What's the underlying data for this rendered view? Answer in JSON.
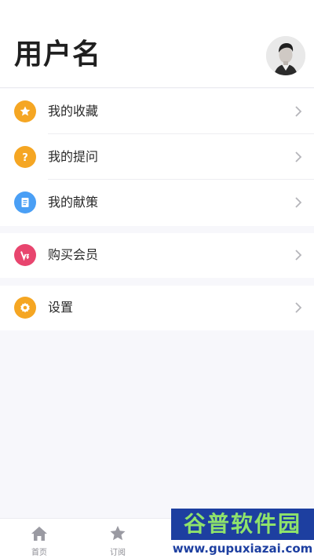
{
  "profile": {
    "username": "用户名"
  },
  "menu": {
    "group1": [
      {
        "label": "我的收藏",
        "icon": "star-icon",
        "color": "#f5a623"
      },
      {
        "label": "我的提问",
        "icon": "question-icon",
        "color": "#f5a623"
      },
      {
        "label": "我的献策",
        "icon": "document-icon",
        "color": "#4a9ff5"
      }
    ],
    "group2": [
      {
        "label": "购买会员",
        "icon": "vip-icon",
        "color": "#e8456e"
      }
    ],
    "group3": [
      {
        "label": "设置",
        "icon": "gear-icon",
        "color": "#f5a623"
      }
    ]
  },
  "tabbar": {
    "tabs": [
      {
        "label": "首页",
        "icon": "home-icon"
      },
      {
        "label": "订阅",
        "icon": "star-icon"
      }
    ]
  },
  "watermark": {
    "title": "谷普软件园",
    "url": "www.gupuxiazai.com"
  },
  "colors": {
    "accent_orange": "#f5a623",
    "accent_blue": "#4a9ff5",
    "accent_pink": "#e8456e",
    "background": "#f7f7fb"
  }
}
